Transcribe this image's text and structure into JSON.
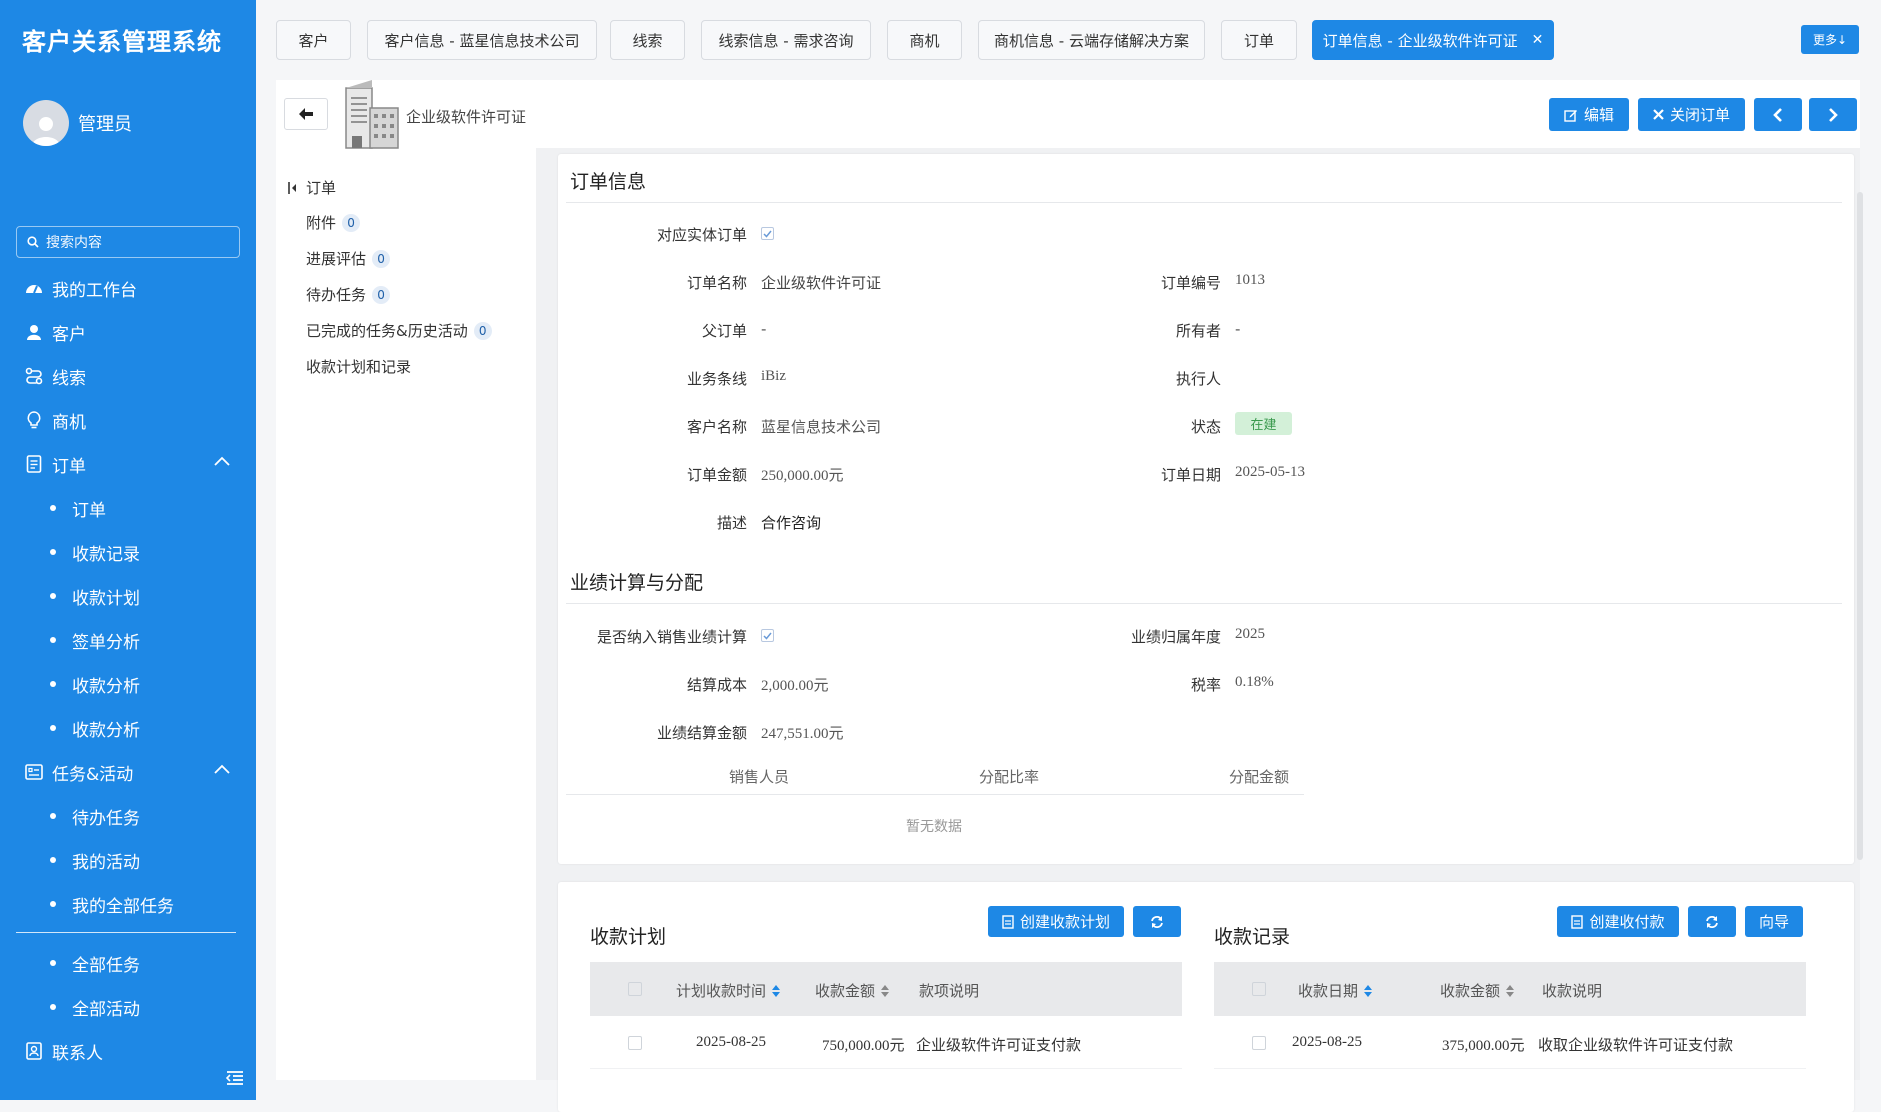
{
  "app": {
    "title": "客户关系管理系统",
    "username": "管理员"
  },
  "search": {
    "placeholder": "搜索内容"
  },
  "nav": {
    "workbench": "我的工作台",
    "customers": "客户",
    "leads": "线索",
    "opportunities": "商机",
    "orders": "订单",
    "orders_sub": [
      "订单",
      "收款记录",
      "收款计划",
      "签单分析",
      "收款分析",
      "收款分析"
    ],
    "tasks": "任务&活动",
    "tasks_sub": [
      "待办任务",
      "我的活动",
      "我的全部任务"
    ],
    "tasks_sub2": [
      "全部任务",
      "全部活动"
    ],
    "contacts": "联系人"
  },
  "tabs": [
    "客户",
    "客户信息 - 蓝星信息技术公司",
    "线索",
    "线索信息 - 需求咨询",
    "商机",
    "商机信息 - 云端存储解决方案",
    "订单",
    "订单信息 - 企业级软件许可证"
  ],
  "more_label": "更多↓",
  "header": {
    "title": "企业级软件许可证",
    "edit": "编辑",
    "close_order": "关闭订单"
  },
  "subnav": {
    "order": "订单",
    "attachments": "附件",
    "attachments_count": "0",
    "progress": "进展评估",
    "progress_count": "0",
    "todo": "待办任务",
    "todo_count": "0",
    "completed": "已完成的任务&历史活动",
    "completed_count": "0",
    "payments": "收款计划和记录"
  },
  "order_info": {
    "section_title": "订单信息",
    "physical_label": "对应实体订单",
    "name_label": "订单名称",
    "name": "企业级软件许可证",
    "no_label": "订单编号",
    "no": "1013",
    "parent_label": "父订单",
    "parent": "-",
    "owner_label": "所有者",
    "owner": "-",
    "biz_label": "业务条线",
    "biz": "iBiz",
    "executor_label": "执行人",
    "executor": "",
    "customer_label": "客户名称",
    "customer": "蓝星信息技术公司",
    "status_label": "状态",
    "status": "在建",
    "amount_label": "订单金额",
    "amount": "250,000.00元",
    "date_label": "订单日期",
    "date": "2025-05-13",
    "desc_label": "描述",
    "desc": "合作咨询"
  },
  "performance": {
    "section_title": "业绩计算与分配",
    "include_label": "是否纳入销售业绩计算",
    "year_label": "业绩归属年度",
    "year": "2025",
    "cost_label": "结算成本",
    "cost": "2,000.00元",
    "tax_label": "税率",
    "tax": "0.18%",
    "settle_label": "业绩结算金额",
    "settle": "247,551.00元",
    "columns": [
      "销售人员",
      "分配比率",
      "分配金额"
    ],
    "empty": "暂无数据"
  },
  "plan": {
    "title": "收款计划",
    "create": "创建收款计划",
    "columns": [
      "计划收款时间",
      "收款金额",
      "款项说明"
    ],
    "rows": [
      {
        "date": "2025-08-25",
        "amount": "750,000.00元",
        "desc": "企业级软件许可证支付款"
      }
    ]
  },
  "records": {
    "title": "收款记录",
    "create": "创建收付款",
    "guide": "向导",
    "columns": [
      "收款日期",
      "收款金额",
      "收款说明"
    ],
    "rows": [
      {
        "date": "2025-08-25",
        "amount": "375,000.00元",
        "desc": "收取企业级软件许可证支付款"
      }
    ]
  },
  "colors": {
    "primary": "#1e88e5",
    "status_bg": "#d3f0d8",
    "status_fg": "#3a9a4e"
  }
}
